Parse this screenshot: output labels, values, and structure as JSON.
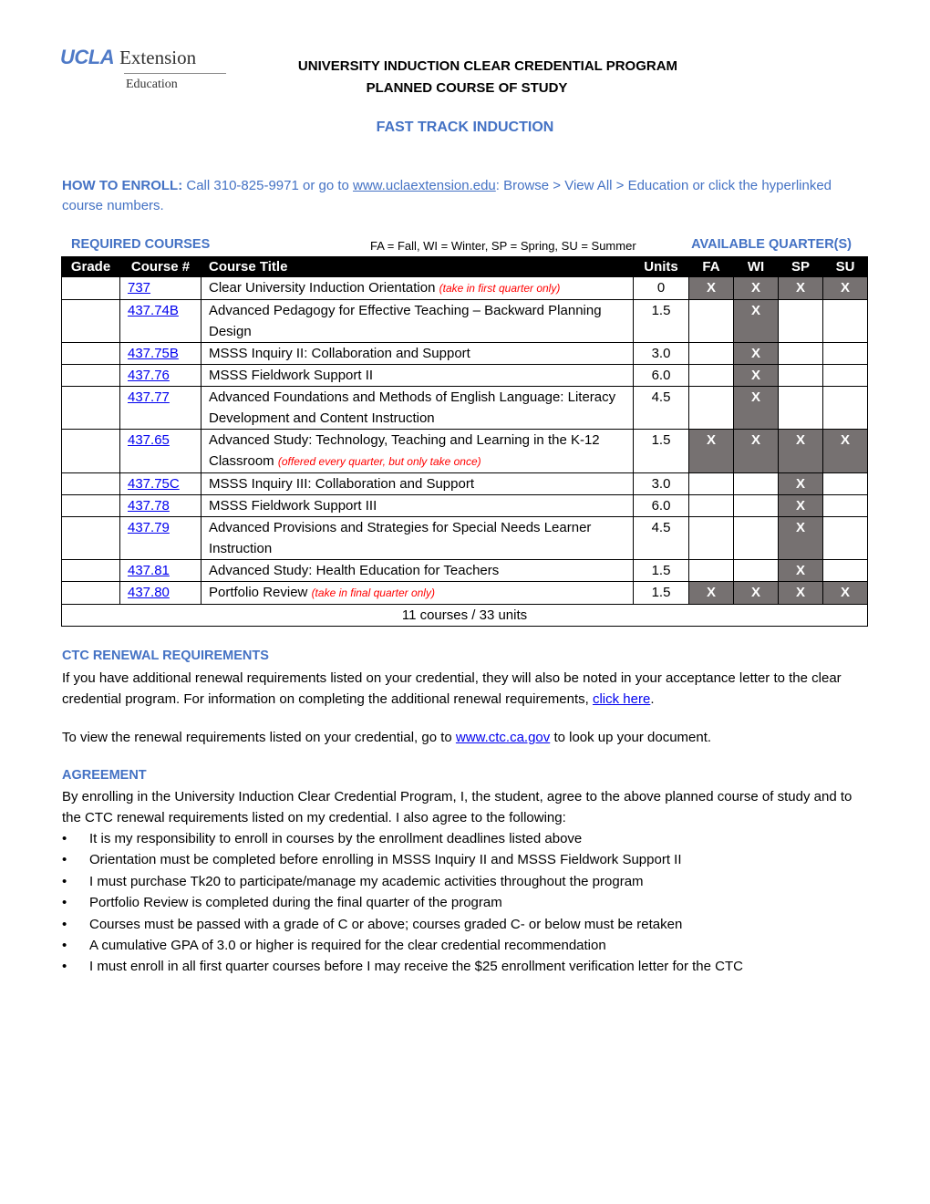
{
  "logo": {
    "brand": "UCLA",
    "name": "Extension",
    "division": "Education"
  },
  "header": {
    "title_line1": "UNIVERSITY INDUCTION CLEAR CREDENTIAL PROGRAM",
    "title_line2": "PLANNED COURSE OF STUDY",
    "subtitle": "FAST TRACK INDUCTION"
  },
  "enroll": {
    "label": "HOW TO ENROLL:",
    "text_before": " Call 310-825-9971 or go to ",
    "link": "www.uclaextension.edu",
    "text_after": ": Browse > View All > Education or click the hyperlinked course numbers."
  },
  "table_legend": {
    "required_label": "REQUIRED COURSES",
    "abbreviations": "FA = Fall, WI = Winter, SP = Spring, SU = Summer",
    "available_label": "AVAILABLE QUARTER(S)"
  },
  "table": {
    "headers": [
      "Grade",
      "Course #",
      "Course Title",
      "Units",
      "FA",
      "WI",
      "SP",
      "SU"
    ],
    "rows": [
      {
        "grade": "",
        "course_num": "737",
        "title": "Clear University Induction Orientation",
        "note": "(take in first quarter only)",
        "units": "0",
        "quarters": {
          "FA": "X",
          "WI": "X",
          "SP": "X",
          "SU": "X"
        }
      },
      {
        "grade": "",
        "course_num": "437.74B",
        "title": "Advanced Pedagogy for Effective Teaching – Backward Planning Design",
        "note": "",
        "units": "1.5",
        "quarters": {
          "FA": "",
          "WI": "X",
          "SP": "",
          "SU": ""
        }
      },
      {
        "grade": "",
        "course_num": "437.75B",
        "title": "MSSS Inquiry II: Collaboration and Support",
        "note": "",
        "units": "3.0",
        "quarters": {
          "FA": "",
          "WI": "X",
          "SP": "",
          "SU": ""
        }
      },
      {
        "grade": "",
        "course_num": "437.76",
        "title": "MSSS Fieldwork Support II",
        "note": "",
        "units": "6.0",
        "quarters": {
          "FA": "",
          "WI": "X",
          "SP": "",
          "SU": ""
        }
      },
      {
        "grade": "",
        "course_num": "437.77",
        "title": "Advanced Foundations and Methods of English Language: Literacy Development and Content Instruction",
        "note": "",
        "units": "4.5",
        "quarters": {
          "FA": "",
          "WI": "X",
          "SP": "",
          "SU": ""
        }
      },
      {
        "grade": "",
        "course_num": "437.65",
        "title": "Advanced Study: Technology, Teaching and Learning in the K-12 Classroom",
        "note": "(offered every quarter, but only take once)",
        "units": "1.5",
        "quarters": {
          "FA": "X",
          "WI": "X",
          "SP": "X",
          "SU": "X"
        }
      },
      {
        "grade": "",
        "course_num": "437.75C",
        "title": "MSSS Inquiry III: Collaboration and Support",
        "note": "",
        "units": "3.0",
        "quarters": {
          "FA": "",
          "WI": "",
          "SP": "X",
          "SU": ""
        }
      },
      {
        "grade": "",
        "course_num": "437.78",
        "title": "MSSS Fieldwork Support III",
        "note": "",
        "units": "6.0",
        "quarters": {
          "FA": "",
          "WI": "",
          "SP": "X",
          "SU": ""
        }
      },
      {
        "grade": "",
        "course_num": "437.79",
        "title": "Advanced Provisions and Strategies for Special Needs Learner Instruction",
        "note": "",
        "units": "4.5",
        "quarters": {
          "FA": "",
          "WI": "",
          "SP": "X",
          "SU": ""
        }
      },
      {
        "grade": "",
        "course_num": "437.81",
        "title": "Advanced Study: Health Education for Teachers",
        "note": "",
        "units": "1.5",
        "quarters": {
          "FA": "",
          "WI": "",
          "SP": "X",
          "SU": ""
        }
      },
      {
        "grade": "",
        "course_num": "437.80",
        "title": "Portfolio Review",
        "note": "(take in final quarter only)",
        "units": "1.5",
        "quarters": {
          "FA": "X",
          "WI": "X",
          "SP": "X",
          "SU": "X"
        }
      }
    ],
    "total": "11 courses / 33 units"
  },
  "ctc": {
    "heading": "CTC RENEWAL REQUIREMENTS",
    "para1_text": "If you have additional renewal requirements listed on your credential, they will also be noted in your acceptance letter to the clear credential program. For information on completing the additional renewal requirements, ",
    "para1_link": "click here",
    "para1_end": ".",
    "para2_before": "To view the renewal requirements listed on your credential, go to ",
    "para2_link": "www.ctc.ca.gov",
    "para2_after": " to look up your document."
  },
  "agreement": {
    "heading": "AGREEMENT",
    "intro": "By enrolling in the University Induction Clear Credential Program, I, the student, agree to the above planned course of study and to the CTC renewal requirements listed on my credential. I also agree to the following:",
    "bullet_glyph": "•",
    "items": [
      "It is my responsibility to enroll in courses by the enrollment deadlines listed above",
      "Orientation must be completed before enrolling in MSSS Inquiry II and MSSS Fieldwork Support II",
      "I must purchase Tk20 to participate/manage my academic activities throughout the program",
      "Portfolio Review is completed during the final quarter of the program",
      "Courses must be passed with a grade of C or above; courses graded C- or below must be retaken",
      "A cumulative GPA of 3.0 or higher is required for the clear credential recommendation",
      "I must enroll in all first quarter courses before I may receive the $25 enrollment verification letter for the CTC"
    ]
  },
  "colors": {
    "accent_blue": "#4472c4",
    "link_blue": "#0000ee",
    "note_red": "#ff0000",
    "available_cell": "#767171",
    "header_black": "#000000"
  }
}
